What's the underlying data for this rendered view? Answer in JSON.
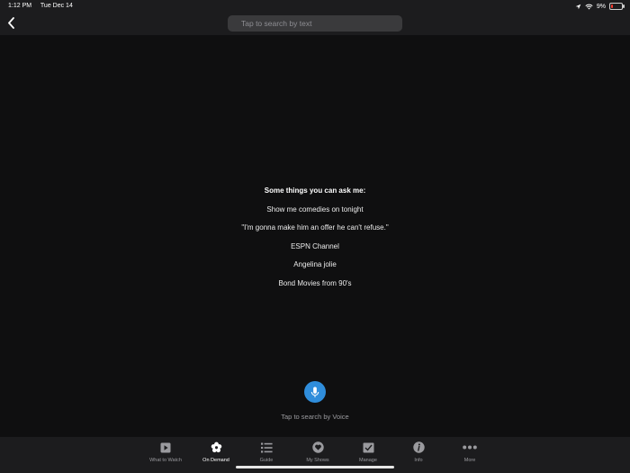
{
  "status": {
    "time": "1:12 PM",
    "date": "Tue Dec 14",
    "battery": "9%"
  },
  "search": {
    "placeholder": "Tap to search by text"
  },
  "suggestions": {
    "title": "Some things you can ask me:",
    "items": [
      "Show me comedies on tonight",
      "\"I'm gonna make him an offer he can't refuse.\"",
      "ESPN Channel",
      "Angelina jolie",
      "Bond Movies from 90's"
    ]
  },
  "voice": {
    "label": "Tap to search by Voice",
    "icon": "microphone-icon",
    "accent": "#2f8ddb"
  },
  "tabs": [
    {
      "label": "What to Watch",
      "icon": "play-icon"
    },
    {
      "label": "On Demand",
      "icon": "on-demand-icon",
      "active": true
    },
    {
      "label": "Guide",
      "icon": "list-icon"
    },
    {
      "label": "My Shows",
      "icon": "heart-icon"
    },
    {
      "label": "Manage",
      "icon": "checkbox-icon"
    },
    {
      "label": "Info",
      "icon": "info-icon"
    },
    {
      "label": "More",
      "icon": "more-icon"
    }
  ]
}
